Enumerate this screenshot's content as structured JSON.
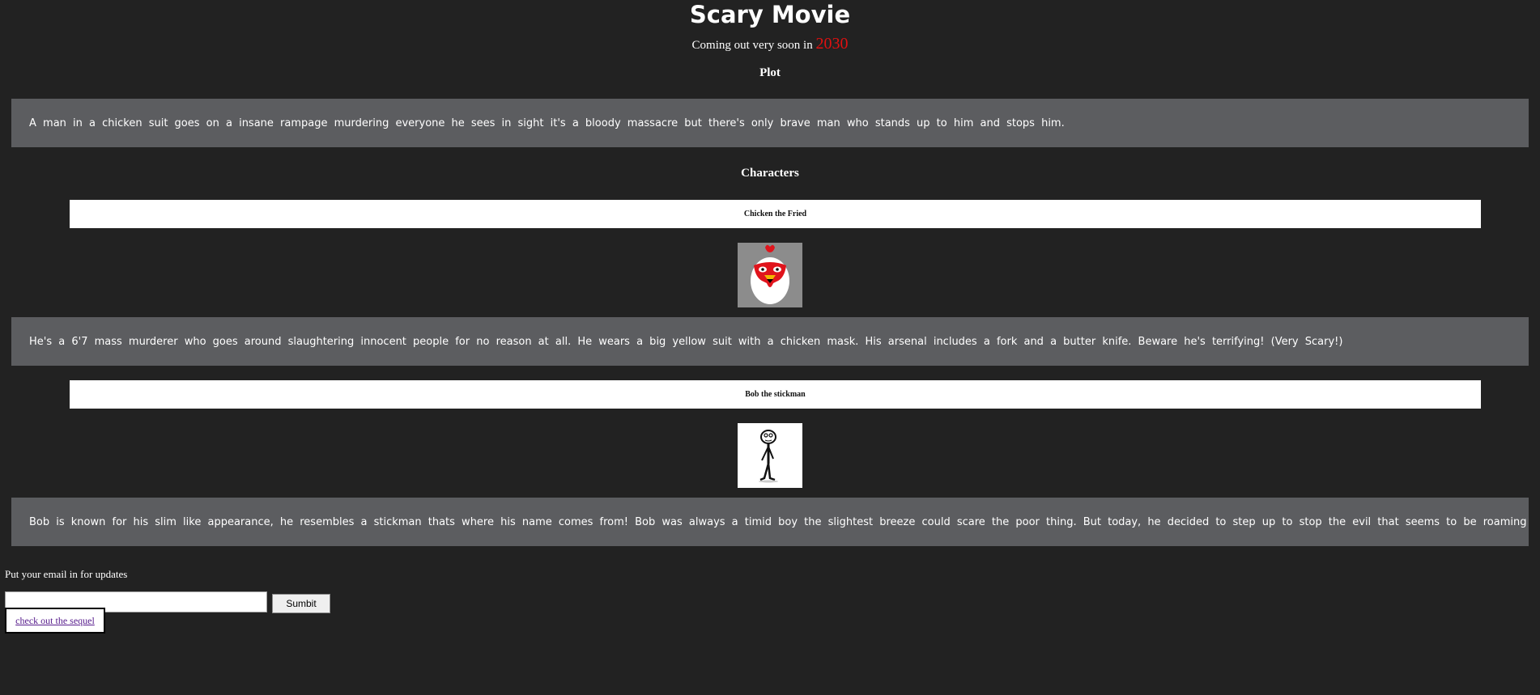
{
  "header": {
    "title": "Scary Movie",
    "subtitle_prefix": "Coming out very soon in ",
    "release_year": "2030",
    "year_color": "#e01010"
  },
  "plot": {
    "heading": "Plot",
    "text": "A man in a chicken suit goes on a insane rampage murdering everyone he sees in sight it's a bloody massacre but there's only brave man who stands up to him and stops him."
  },
  "characters": {
    "heading": "Characters",
    "items": [
      {
        "name": "Chicken the Fried",
        "image_icon": "chicken-mask-icon",
        "description": "He's a 6'7 mass murderer who goes around slaughtering innocent people for no reason at all. He wears a big yellow suit with a chicken mask. His arsenal includes a fork and a butter knife. Beware he's terrifying! (Very Scary!)"
      },
      {
        "name": "Bob the stickman",
        "image_icon": "stickman-icon",
        "description": "Bob is known for his slim like appearance, he resembles a stickman thats where his name comes from! Bob was always a timid boy the slightest breeze could scare the poor thing. But today, he decided to step up to stop the evil that seems to be roaming around town."
      }
    ]
  },
  "signup": {
    "label": "Put your email in for updates",
    "email_value": "",
    "submit_label": "Sumbit"
  },
  "sequel_link": {
    "label": "check out the sequel"
  },
  "colors": {
    "background": "#222222",
    "box": "#5c5d60",
    "link": "#551a8b"
  }
}
